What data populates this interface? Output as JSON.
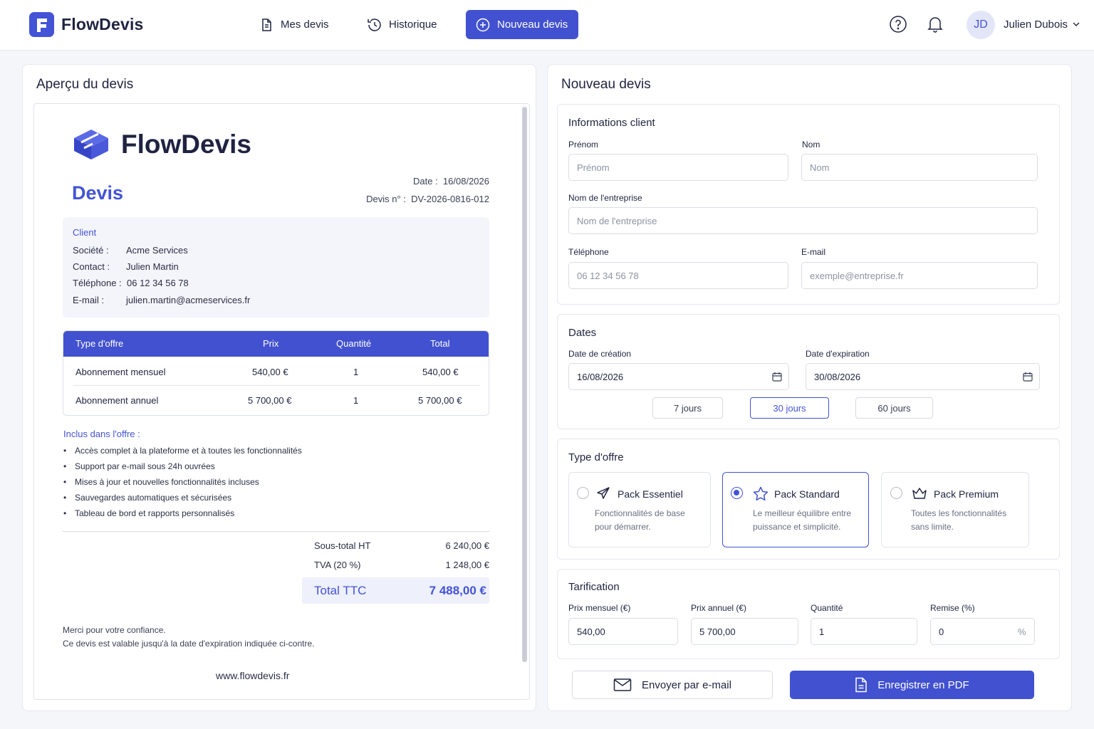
{
  "app": {
    "brand": "FlowDevis"
  },
  "nav": {
    "items": [
      {
        "label": "Mes devis",
        "icon": "document-icon"
      },
      {
        "label": "Historique",
        "icon": "history-icon"
      },
      {
        "label": "Nouveau devis",
        "icon": "plus-circle-icon",
        "active": true
      }
    ]
  },
  "user": {
    "initials": "JD",
    "name": "Julien Dubois"
  },
  "colors": {
    "accent": "#4151cf",
    "accent_light": "#eef0fb",
    "text": "#1f2340"
  },
  "preview": {
    "title": "Aperçu du devis",
    "brand": "FlowDevis",
    "heading": "Devis",
    "date_label": "Date :",
    "date_value": "16/08/2026",
    "number_label": "Devis n° :",
    "number_value": "DV-2026-0816-012",
    "client": {
      "heading": "Client",
      "rows": [
        {
          "label": "Société :",
          "value": "Acme Services"
        },
        {
          "label": "Contact :",
          "value": "Julien Martin"
        },
        {
          "label": "Téléphone :",
          "value": "06 12 34 56 78"
        },
        {
          "label": "E-mail :",
          "value": "julien.martin@acmeservices.fr"
        }
      ]
    },
    "table": {
      "headers": [
        "Type d'offre",
        "Prix",
        "Quantité",
        "Total"
      ],
      "rows": [
        [
          "Abonnement mensuel",
          "540,00 €",
          "1",
          "540,00 €"
        ],
        [
          "Abonnement annuel",
          "5 700,00 €",
          "1",
          "5 700,00 €"
        ]
      ]
    },
    "included": {
      "heading": "Inclus dans l'offre :",
      "items": [
        "Accès complet à la plateforme et à toutes les fonctionnalités",
        "Support par e-mail sous 24h ouvrées",
        "Mises à jour et nouvelles fonctionnalités incluses",
        "Sauvegardes automatiques et sécurisées",
        "Tableau de bord et rapports personnalisés"
      ]
    },
    "totals": {
      "subtotal_label": "Sous-total HT",
      "subtotal_value": "6 240,00 €",
      "vat_label": "TVA (20 %)",
      "vat_value": "1 248,00 €",
      "total_label": "Total TTC",
      "total_value": "7 488,00 €"
    },
    "footer": {
      "thanks": "Merci pour votre confiance.",
      "validity": "Ce devis est valable jusqu'à la date d'expiration indiquée ci-contre.",
      "website": "www.flowdevis.fr"
    }
  },
  "form": {
    "title": "Nouveau devis",
    "client": {
      "heading": "Informations client",
      "first_name": {
        "label": "Prénom",
        "placeholder": "Prénom",
        "value": ""
      },
      "last_name": {
        "label": "Nom",
        "placeholder": "Nom",
        "value": ""
      },
      "company": {
        "label": "Nom de l'entreprise",
        "placeholder": "Nom de l'entreprise",
        "value": ""
      },
      "phone": {
        "label": "Téléphone",
        "placeholder": "06 12 34 56 78",
        "value": ""
      },
      "email": {
        "label": "E-mail",
        "placeholder": "exemple@entreprise.fr",
        "value": ""
      }
    },
    "dates": {
      "heading": "Dates",
      "created": {
        "label": "Date de création",
        "value": "16/08/2026"
      },
      "expires": {
        "label": "Date d'expiration",
        "value": "30/08/2026"
      },
      "presets": [
        {
          "label": "7 jours",
          "selected": false
        },
        {
          "label": "30 jours",
          "selected": true
        },
        {
          "label": "60 jours",
          "selected": false
        }
      ]
    },
    "offer": {
      "heading": "Type d'offre",
      "options": [
        {
          "title": "Pack Essentiel",
          "desc": "Fonctionnalités de base pour démarrer.",
          "icon": "paper-plane-icon",
          "selected": false
        },
        {
          "title": "Pack Standard",
          "desc": "Le meilleur équilibre entre puissance et simplicité.",
          "icon": "star-icon",
          "selected": true
        },
        {
          "title": "Pack Premium",
          "desc": "Toutes les fonctionnalités sans limite.",
          "icon": "crown-icon",
          "selected": false
        }
      ]
    },
    "pricing": {
      "heading": "Tarification",
      "monthly": {
        "label": "Prix mensuel (€)",
        "value": "540,00"
      },
      "annual": {
        "label": "Prix annuel (€)",
        "value": "5 700,00"
      },
      "quantity": {
        "label": "Quantité",
        "value": "1"
      },
      "discount": {
        "label": "Remise (%)",
        "value": "0",
        "suffix": "%"
      }
    },
    "actions": {
      "email": "Envoyer par e-mail",
      "pdf": "Enregistrer en PDF"
    }
  }
}
